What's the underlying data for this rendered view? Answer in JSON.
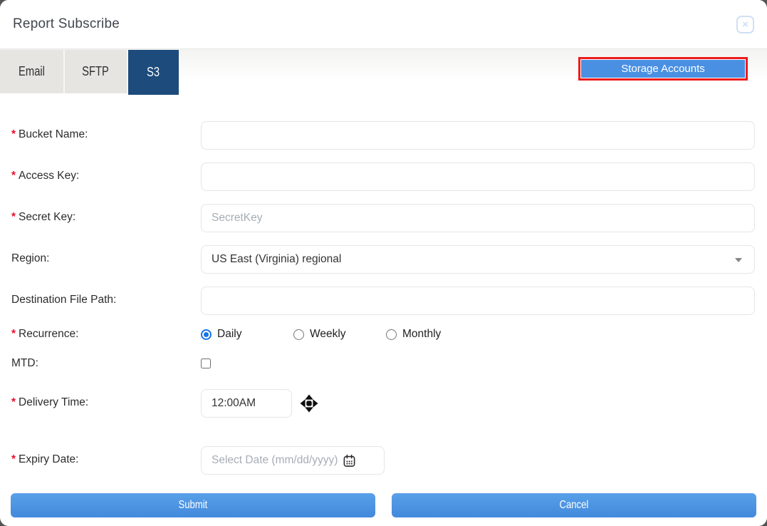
{
  "dialog": {
    "title": "Report Subscribe"
  },
  "icons": {
    "close_icon": "×",
    "chevron_down_icon": "css-triangle-down",
    "time_picker_move_icon": "svg-diamond-move",
    "calendar_icon": "svg-calendar-outline"
  },
  "tabs": [
    {
      "label": "Email",
      "active": false
    },
    {
      "label": "SFTP",
      "active": false
    },
    {
      "label": "S3",
      "active": true
    }
  ],
  "toolbar": {
    "storage_accounts_label": "Storage Accounts",
    "highlighted_with_red_box": true
  },
  "form": {
    "bucket_name": {
      "star": "*",
      "label": "Bucket Name:",
      "value": "",
      "placeholder": ""
    },
    "access_key": {
      "star": "*",
      "label": "Access Key:",
      "value": "",
      "placeholder": ""
    },
    "secret_key": {
      "star": "*",
      "label": "Secret Key:",
      "value": "",
      "placeholder": "SecretKey"
    },
    "region": {
      "star": "",
      "label": "Region:",
      "selected_option": "US East (Virginia) regional"
    },
    "destination_file_path": {
      "star": "",
      "label": "Destination File Path:",
      "value": "",
      "placeholder": ""
    },
    "recurrence": {
      "star": "*",
      "label": "Recurrence:",
      "options": [
        {
          "label": "Daily",
          "selected": true
        },
        {
          "label": "Weekly",
          "selected": false
        },
        {
          "label": "Monthly",
          "selected": false
        }
      ]
    },
    "mtd": {
      "star": "",
      "label": "MTD:",
      "checked": false
    },
    "delivery_time": {
      "star": "*",
      "label": "Delivery Time:",
      "value": "12:00AM"
    },
    "expiry_date": {
      "star": "*",
      "label": "Expiry Date:",
      "value": "",
      "placeholder": "Select Date (mm/dd/yyyy)"
    }
  },
  "footer": {
    "submit_label": "Submit",
    "cancel_label": "Cancel"
  },
  "colors": {
    "accent_blue": "#4a90e2",
    "active_tab_navy": "#1c4b7c",
    "highlight_red": "#ed1c1c",
    "required_asterisk_red": "#e8112d",
    "close_icon_pale_blue": "#cfe0f4"
  }
}
